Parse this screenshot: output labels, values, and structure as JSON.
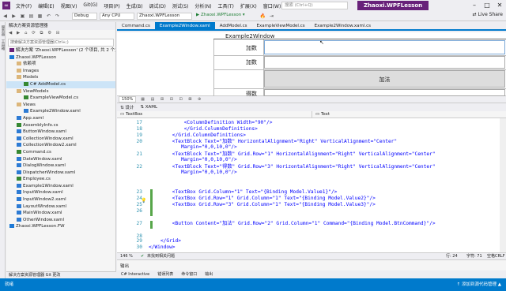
{
  "menubar": {
    "items": [
      "文件(F)",
      "编辑(E)",
      "视图(V)",
      "Git(G)",
      "项目(P)",
      "生成(B)",
      "调试(D)",
      "测试(S)",
      "分析(N)",
      "工具(T)",
      "扩展(X)",
      "窗口(W)",
      "帮助(H)"
    ],
    "search_placeholder": "搜索 (Ctrl+Q)",
    "solution_title": "Zhaoxi.WPFLesson"
  },
  "toolbar": {
    "config": "Debug",
    "platform": "Any CPU",
    "project": "Zhaoxi.WPFLesson",
    "run_label": "▶ Zhaoxi.WPFLesson ▾",
    "live_share": "Live Share"
  },
  "solution_explorer": {
    "title": "解决方案资源管理器",
    "search_placeholder": "搜索解决方案资源管理器(Ctrl+;)",
    "items": [
      {
        "label": "解决方案 'Zhaoxi.WPFLesson' (2 个项目, 共 2 个)",
        "level": 0,
        "icon": "sol"
      },
      {
        "label": "Zhaoxi.WPFLesson",
        "level": 0,
        "icon": "proj"
      },
      {
        "label": "依赖项",
        "level": 1,
        "icon": "fol"
      },
      {
        "label": "Images",
        "level": 1,
        "icon": "fol"
      },
      {
        "label": "Models",
        "level": 1,
        "icon": "fol"
      },
      {
        "label": "C# AddModel.cs",
        "level": 2,
        "icon": "cs",
        "selected": true
      },
      {
        "label": "ViewModels",
        "level": 1,
        "icon": "fol"
      },
      {
        "label": "ExampleViewModel.cs",
        "level": 2,
        "icon": "cs"
      },
      {
        "label": "Views",
        "level": 1,
        "icon": "fol"
      },
      {
        "label": "Example2Window.xaml",
        "level": 2,
        "icon": "xa"
      },
      {
        "label": "App.xaml",
        "level": 1,
        "icon": "xa"
      },
      {
        "label": "AssemblyInfo.cs",
        "level": 1,
        "icon": "cs"
      },
      {
        "label": "ButtonWindow.xaml",
        "level": 1,
        "icon": "xa"
      },
      {
        "label": "CollectionWindow.xaml",
        "level": 1,
        "icon": "xa"
      },
      {
        "label": "CollectionWindow2.xaml",
        "level": 1,
        "icon": "xa"
      },
      {
        "label": "Command.cs",
        "level": 1,
        "icon": "cs"
      },
      {
        "label": "DateWindow.xaml",
        "level": 1,
        "icon": "xa"
      },
      {
        "label": "DialogWindow.xaml",
        "level": 1,
        "icon": "xa"
      },
      {
        "label": "DispatcherWindow.xaml",
        "level": 1,
        "icon": "xa"
      },
      {
        "label": "Employee.cs",
        "level": 1,
        "icon": "cs"
      },
      {
        "label": "Example1Window.xaml",
        "level": 1,
        "icon": "xa"
      },
      {
        "label": "InputWindow.xaml",
        "level": 1,
        "icon": "xa"
      },
      {
        "label": "InputWindow2.xaml",
        "level": 1,
        "icon": "xa"
      },
      {
        "label": "LayoutWindow.xaml",
        "level": 1,
        "icon": "xa"
      },
      {
        "label": "MainWindow.xaml",
        "level": 1,
        "icon": "xa"
      },
      {
        "label": "OtherWindow.xaml",
        "level": 1,
        "icon": "xa"
      },
      {
        "label": "Zhaoxi.WPFLesson.FW",
        "level": 0,
        "icon": "proj"
      }
    ],
    "bottom_tabs": "解决方案资源管理器  Git 更改"
  },
  "tabs": [
    "Command.cs",
    "Example2Window.xaml",
    "AddModel.cs",
    "ExampleViewModel.cs",
    "Example2Window.xaml.cs"
  ],
  "designer": {
    "window_title": "Example2Window",
    "labels": [
      "加数",
      "加数",
      "得数"
    ],
    "button": "加法"
  },
  "zoom": "150%",
  "split": {
    "design": "设计",
    "xaml": "XAML"
  },
  "nav": {
    "left": "TextBox",
    "right": "Text"
  },
  "code": [
    {
      "n": "17",
      "line": "            <ColumnDefinition Width=\"90\"/>"
    },
    {
      "n": "18",
      "line": "            </Grid.ColumnDefinitions>"
    },
    {
      "n": "19",
      "line": "        </Grid.ColumnDefinitions>"
    },
    {
      "n": "20",
      "line": "        <TextBlock Text=\"加数\" HorizontalAlignment=\"Right\" VerticalAlignment=\"Center\"",
      "cont": "           Margin=\"0,0,10,0\"/>"
    },
    {
      "n": "21",
      "line": "        <TextBlock Text=\"加数\" Grid.Row=\"1\" HorizontalAlignment=\"Right\" VerticalAlignment=\"Center\"",
      "cont": "           Margin=\"0,0,10,0\"/>"
    },
    {
      "n": "22",
      "line": "        <TextBlock Text=\"得数\" Grid.Row=\"3\" HorizontalAlignment=\"Right\" VerticalAlignment=\"Center\"",
      "cont": "           Margin=\"0,0,10,0\"/>"
    },
    {
      "n": "23",
      "line": "        <TextBox Grid.Column=\"1\" Text=\"{Binding Model.Value1}\"/>"
    },
    {
      "n": "24",
      "line": "        <TextBox Grid.Row=\"1\" Grid.Column=\"1\" Text=\"{Binding Model.Value2}\"/>"
    },
    {
      "n": "25",
      "line": "        <TextBox Grid.Row=\"3\" Grid.Column=\"1\" Text=\"{Binding Model.Value3}\"/>"
    },
    {
      "n": "26",
      "line": ""
    },
    {
      "n": "27",
      "line": "        <Button Content=\"加法\" Grid.Row=\"2\" Grid.Column=\"1\" Command=\"{Binding Model.BtnCommand}\"/>"
    },
    {
      "n": "28",
      "line": ""
    },
    {
      "n": "29",
      "line": "    </Grid>"
    },
    {
      "n": "30",
      "line": "</Window>"
    }
  ],
  "editor_status": {
    "zoom": "146 %",
    "issues": "未找到相关问题",
    "ln": "行: 24",
    "ch": "字符: 71",
    "space": "空格",
    "eol": "CRLF"
  },
  "output": {
    "title": "输出"
  },
  "bottom_tabs": [
    "C# Interactive",
    "错误列表",
    "命令窗口",
    "输出"
  ],
  "statusbar": {
    "left": "就绪",
    "right": "↑ 添加到源代码管理 ▲"
  }
}
